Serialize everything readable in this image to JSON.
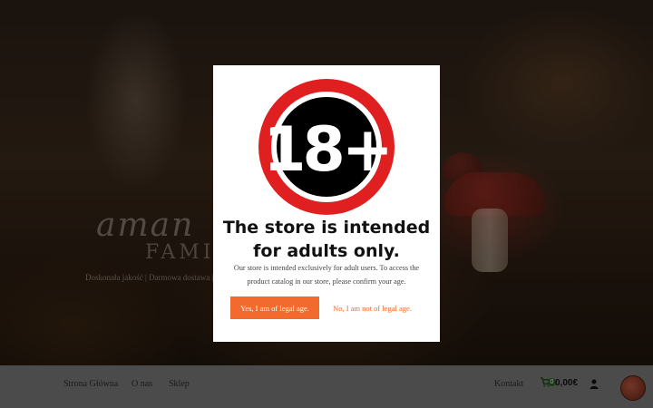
{
  "brand": {
    "logo_script": "aman",
    "logo_family": "FAMIL",
    "tagline": "Doskonała jakość | Darmowa dostawa | D"
  },
  "nav": {
    "items": [
      {
        "label": "Strona Główna"
      },
      {
        "label": "O nas"
      },
      {
        "label": "Sklep"
      },
      {
        "label": "Kontakt"
      }
    ],
    "cart_count": "0",
    "cart_total": "0,00€"
  },
  "modal": {
    "badge_text": "18+",
    "title_line1": "The store is intended",
    "title_line2": "for adults only.",
    "description": "Our store is intended exclusively for adult users. To access the product catalog in our store, please confirm your age.",
    "yes_label": "Yes, I am of legal age.",
    "no_label": "No, I am not of legal age."
  },
  "colors": {
    "accent": "#f26a2e",
    "badge_ring": "#e02020",
    "badge_center": "#000000"
  },
  "icons": {
    "cart": "cart-icon",
    "user": "user-icon",
    "globe": "globe-icon"
  }
}
